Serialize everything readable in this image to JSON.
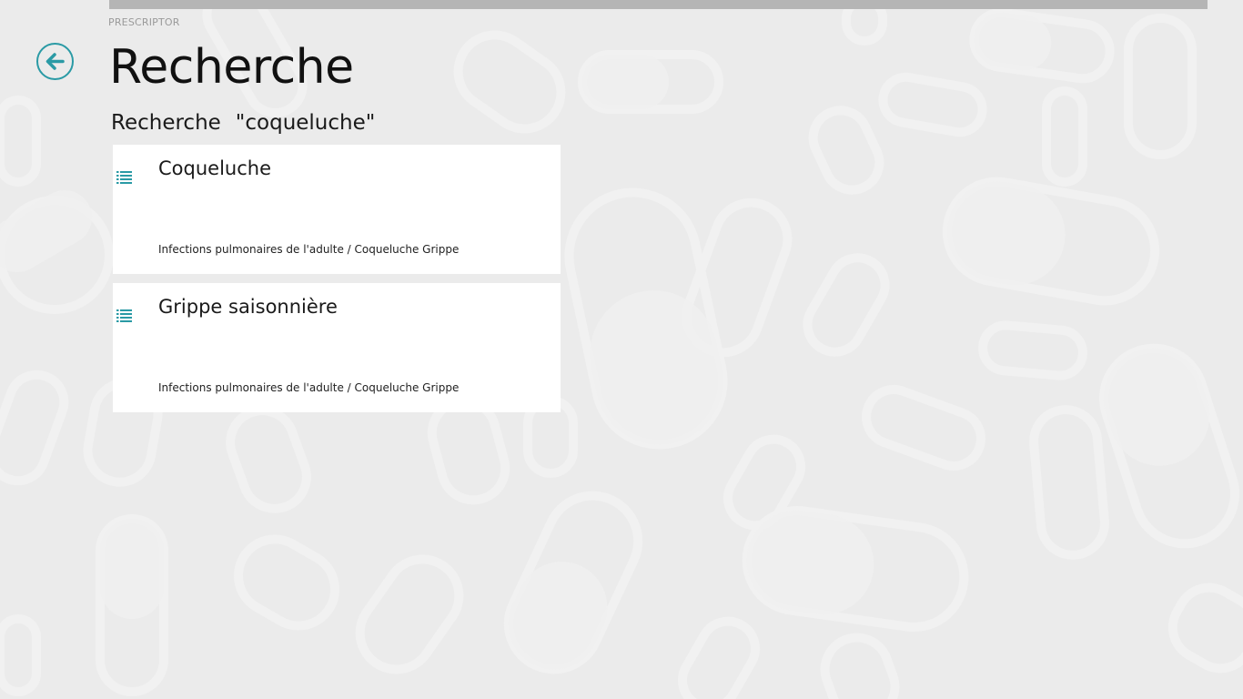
{
  "app": {
    "name": "PRESCRIPTOR"
  },
  "header": {
    "title": "Recherche",
    "back_icon": "arrow-left-circle-icon"
  },
  "search": {
    "label": "Recherche",
    "query": "\"coqueluche\""
  },
  "results": [
    {
      "title": "Coqueluche",
      "path": "Infections pulmonaires de l'adulte / Coqueluche Grippe",
      "icon": "list-icon"
    },
    {
      "title": "Grippe saisonnière",
      "path": "Infections pulmonaires de l'adulte / Coqueluche Grippe",
      "icon": "list-icon"
    }
  ],
  "colors": {
    "accent": "#2a9aa5",
    "background": "#ebebeb",
    "card": "#ffffff",
    "top_bar": "#b5b5b5"
  }
}
